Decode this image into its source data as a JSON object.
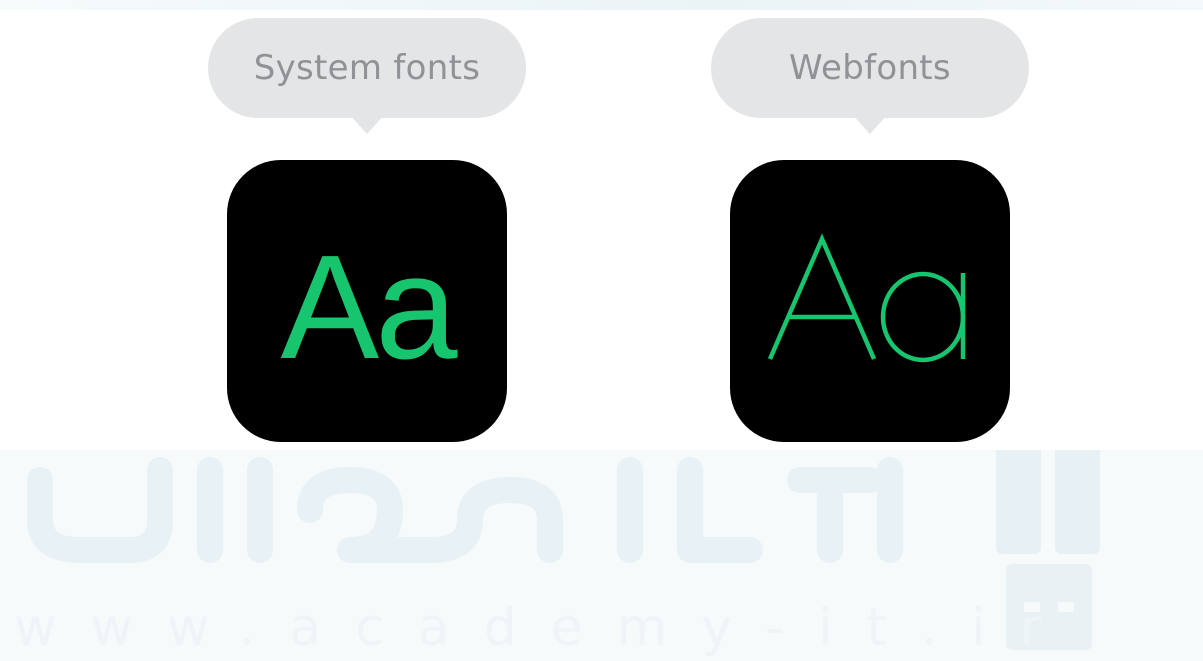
{
  "slide": {
    "system": {
      "label": "System fonts",
      "glyph": "Aa"
    },
    "web": {
      "label": "Webfonts",
      "glyph": "Aa"
    }
  },
  "colors": {
    "bubble": "#e4e5e6",
    "bubble_text": "#8f9397",
    "tile": "#000000",
    "glyph": "#17c56f",
    "watermark": "#eef4f7"
  },
  "watermark": {
    "url": "www.academy-it.ir"
  }
}
